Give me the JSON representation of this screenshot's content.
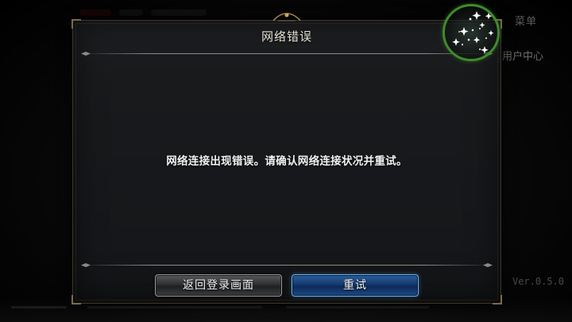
{
  "background": {
    "menu_label": "菜单",
    "user_center_label": "用户中心",
    "version": "Ver.0.5.0"
  },
  "dialog": {
    "title": "网络错误",
    "message": "网络连接出现错误。请确认网络连接状况并重试。",
    "back_button_label": "返回登录画面",
    "retry_button_label": "重试"
  },
  "icons": {
    "menu": "sparkle-menu-icon"
  },
  "colors": {
    "dialog_title": "#e7e2d6",
    "message_text": "#f1f1f1",
    "retry_border": "#6fb4ea",
    "menu_ring": "#3f8a2b"
  }
}
